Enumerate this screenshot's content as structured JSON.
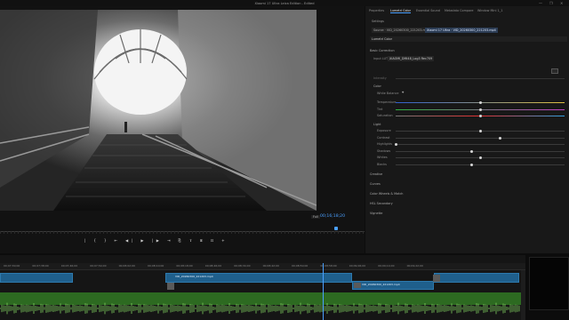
{
  "window": {
    "title": "Xiaomi 17 Ultra Leica Edition - Edited",
    "controls": [
      "—",
      "❐",
      "✕"
    ]
  },
  "program": {
    "timecode": "00;16;18;20",
    "fit": "Full",
    "transport": [
      "|",
      "{",
      "}",
      "⇤",
      "◀|",
      "▶",
      "|▶",
      "⇥",
      "⎘",
      "⇪",
      "⌸",
      "⊡",
      "+"
    ]
  },
  "lumetri": {
    "tabs": [
      "Properties",
      "Lumetri Color",
      "Essential Sound",
      "Metadata Compare",
      "Window Mini 1_1"
    ],
    "active_tab": "Lumetri Color",
    "settings_label": "Settings",
    "source_label": "Source · VID_20260300_221203.mp4",
    "sequence_label": "Xiaomi 17 Ultra · VID_20260300_221203.mp4",
    "preset": "Lumetri Color",
    "sections": {
      "basic": "Basic Correction",
      "input_lut_label": "Input LUT",
      "input_lut_value": "XIAOMI_DMI48_Log3 Rec709",
      "intensity": "Intensity",
      "color": "Color",
      "white_balance": "White Balance",
      "light": "Light",
      "creative": "Creative",
      "curves": "Curves",
      "color_wheels": "Color Wheels & Match",
      "hsl": "HSL Secondary",
      "vignette": "Vignette"
    },
    "color_sliders": [
      {
        "label": "Temperature",
        "value": 0.5
      },
      {
        "label": "Tint",
        "value": 0.5
      },
      {
        "label": "Saturation",
        "value": 0.5
      }
    ],
    "light_sliders": [
      {
        "label": "Exposure",
        "value": 0.5
      },
      {
        "label": "Contrast",
        "value": 0.62
      },
      {
        "label": "Highlights",
        "value": 0.0
      },
      {
        "label": "Shadows",
        "value": 0.45
      },
      {
        "label": "Whites",
        "value": 0.5
      },
      {
        "label": "Blacks",
        "value": 0.45
      }
    ]
  },
  "timeline": {
    "ruler": [
      "00;07;30;00",
      "00;07;38;00",
      "00;07;46;00",
      "00;07;54;00",
      "00;08;02;00",
      "00;08;10;00",
      "00;08;18;00",
      "00;08;26;00",
      "00;08;34;00",
      "00;08;42;00",
      "00;08;50;00",
      "00;08;58;00",
      "00;09;06;00",
      "00;09;14;00",
      "00;09;22;00"
    ],
    "clips": [
      {
        "name": "",
        "track": "v1"
      },
      {
        "name": "VID_20260300_221203.mp4",
        "track": "v1"
      },
      {
        "name": "VID_20260300_221203.mp4",
        "track": "v1"
      },
      {
        "name": "",
        "track": "v1"
      }
    ]
  },
  "colors": {
    "accent": "#4aa0ff",
    "video_clip": "#1f5f8c",
    "audio_clip": "#2d6a21"
  }
}
